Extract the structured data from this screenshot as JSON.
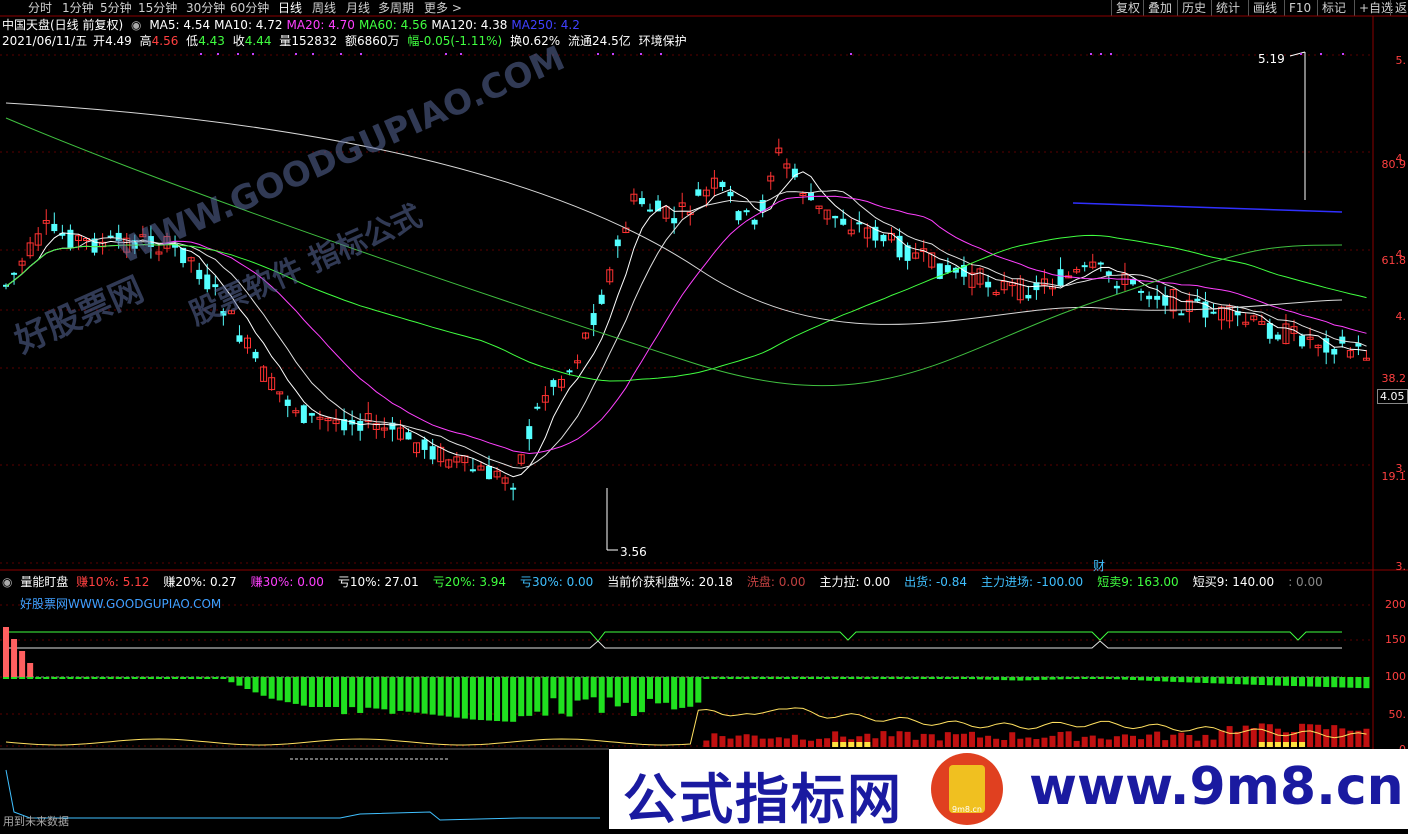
{
  "toolbar": {
    "left": [
      "分时",
      "1分钟",
      "5分钟",
      "15分钟",
      "30分钟",
      "60分钟",
      "日线",
      "周线",
      "月线",
      "多周期",
      "更多"
    ],
    "active": "日线",
    "right": [
      "复权",
      "叠加",
      "历史",
      "统计",
      "画线",
      "F10",
      "标记",
      "+自选",
      "返"
    ]
  },
  "title": {
    "stock": "中国天盘(日线 前复权)",
    "ma": [
      {
        "label": "MA5: 4.54",
        "color": "#ffffff"
      },
      {
        "label": "MA10: 4.72",
        "color": "#ffffff"
      },
      {
        "label": "MA20: 4.70",
        "color": "#ff40ff"
      },
      {
        "label": "MA60: 4.56",
        "color": "#40ff40"
      },
      {
        "label": "MA120: 4.38",
        "color": "#ffffff"
      },
      {
        "label": "MA250: 4.2",
        "color": "#4040ff"
      }
    ]
  },
  "quote": {
    "date": "2021/06/11/五",
    "open_label": "开",
    "open": "4.49",
    "high_label": "高",
    "high": "4.56",
    "low_label": "低",
    "low": "4.43",
    "close_label": "收",
    "close": "4.44",
    "vol_label": "量",
    "vol": "152832",
    "amt_label": "额",
    "amt": "6860万",
    "chg_label": "幅",
    "chg": "-0.05(-1.11%)",
    "turn_label": "换",
    "turn": "0.62%",
    "float_label": "流通",
    "float": "24.5亿",
    "tag": "环境保护"
  },
  "price_labels": {
    "high": "5.19",
    "low": "3.56",
    "current": "4.05",
    "finance": "财"
  },
  "right_axis": {
    "price": [
      "5.",
      "4.",
      "4.",
      "4.",
      "3.",
      "3."
    ],
    "pct": [
      "80.9",
      "61.8",
      "38.2",
      "19.1"
    ]
  },
  "watermark": {
    "line1": "WWW.GOODGUPIAO.COM",
    "line2": "好股票网",
    "line3": "股票软件  指标公式"
  },
  "indicator": {
    "name": "量能盯盘",
    "items": [
      {
        "label": "赚10%: ",
        "value": "5.12",
        "lc": "#ff4040",
        "vc": "#ff4040"
      },
      {
        "label": "赚20%: ",
        "value": "0.27",
        "lc": "#ffffff",
        "vc": "#ffffff"
      },
      {
        "label": "赚30%: ",
        "value": "0.00",
        "lc": "#ff40ff",
        "vc": "#ff40ff"
      },
      {
        "label": "亏10%: ",
        "value": "27.01",
        "lc": "#ffffff",
        "vc": "#ffffff"
      },
      {
        "label": "亏20%: ",
        "value": "3.94",
        "lc": "#40ff40",
        "vc": "#40ff40"
      },
      {
        "label": "亏30%: ",
        "value": "0.00",
        "lc": "#40c0ff",
        "vc": "#40c0ff"
      },
      {
        "label": "当前价获利盘%: ",
        "value": "20.18",
        "lc": "#ffffff",
        "vc": "#ffffff"
      },
      {
        "label": "洗盘: ",
        "value": "0.00",
        "lc": "#c04040",
        "vc": "#c04040"
      },
      {
        "label": "主力拉: ",
        "value": "0.00",
        "lc": "#ffffff",
        "vc": "#ffffff"
      },
      {
        "label": "出货: ",
        "value": "-0.84",
        "lc": "#40c0ff",
        "vc": "#40c0ff"
      },
      {
        "label": "主力进场: ",
        "value": "-100.00",
        "lc": "#40c0ff",
        "vc": "#40c0ff"
      },
      {
        "label": "短卖9: ",
        "value": "163.00",
        "lc": "#40ff40",
        "vc": "#40ff40"
      },
      {
        "label": "短买9: ",
        "value": "140.00",
        "lc": "#ffffff",
        "vc": "#ffffff"
      },
      {
        "label": ": ",
        "value": "0.00",
        "lc": "#888888",
        "vc": "#888888"
      }
    ],
    "site": "好股票网WWW.GOODGUPIAO.COM",
    "axis": [
      "200",
      "150",
      "100",
      "50.",
      "0"
    ],
    "bottom_note": "用到未来数据"
  },
  "ad": {
    "left": "公式指标网",
    "logo": "9m8.cn",
    "right": "www.9m8.cn"
  },
  "colors": {
    "up": "#ff3232",
    "down": "#54ffff",
    "bg": "#000000",
    "axis": "#8b0000"
  }
}
